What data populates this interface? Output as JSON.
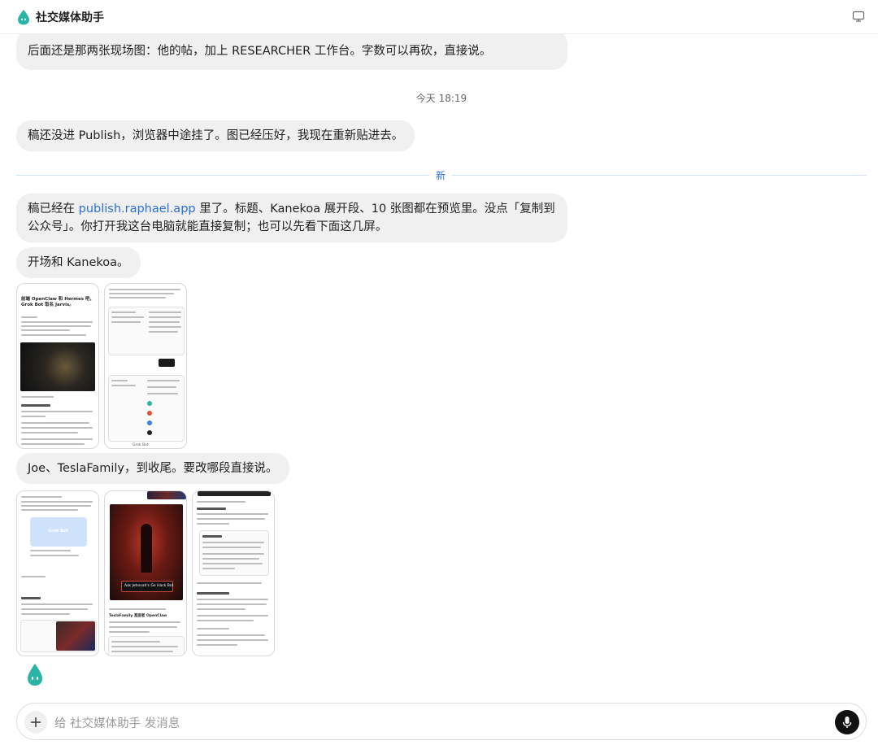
{
  "app": {
    "title": "社交媒体助手",
    "brand_color": "#2bb3a6"
  },
  "messages": {
    "m1": "后面还是那两张现场图：他的帖，加上 RESEARCHER 工作台。字数可以再砍，直接说。",
    "timestamp": "今天 18:19",
    "m2": "稿还没进 Publish，浏览器中途挂了。图已经压好，我现在重新贴进去。",
    "divider_label": "新",
    "m3_prefix": "稿已经在 ",
    "m3_link": "publish.raphael.app",
    "m3_line1_rest": " 里了。标题、Kanekoa 展开段、10 张图都在预览里。没点「复制到",
    "m3_line2": "公众号」。你打开我这台电脑就能直接复制；也可以先看下面这几屏。",
    "m4": "开场和 Kanekoa。",
    "m5": "Joe、TeslaFamily，到收尾。要改哪段直接说。"
  },
  "thumbs_group1": {
    "t1_heading": "前端 OpenClaw 和 Hermes 吧，Grok Bot 取名 Jarvis。",
    "t2_badge": "Grok Bot"
  },
  "thumbs_group2": {
    "t1_brand": "Grok Bot",
    "t2_caption": "Ask Jehovah's Ge Hack Bot",
    "t3_heading": "TeslaFamily 直面者 OpenClaw"
  },
  "composer": {
    "placeholder": "给 社交媒体助手 发消息"
  },
  "icons": {
    "logo": "water-drop-icon",
    "monitor": "monitor-icon",
    "plus": "plus-icon",
    "mic": "microphone-icon"
  }
}
